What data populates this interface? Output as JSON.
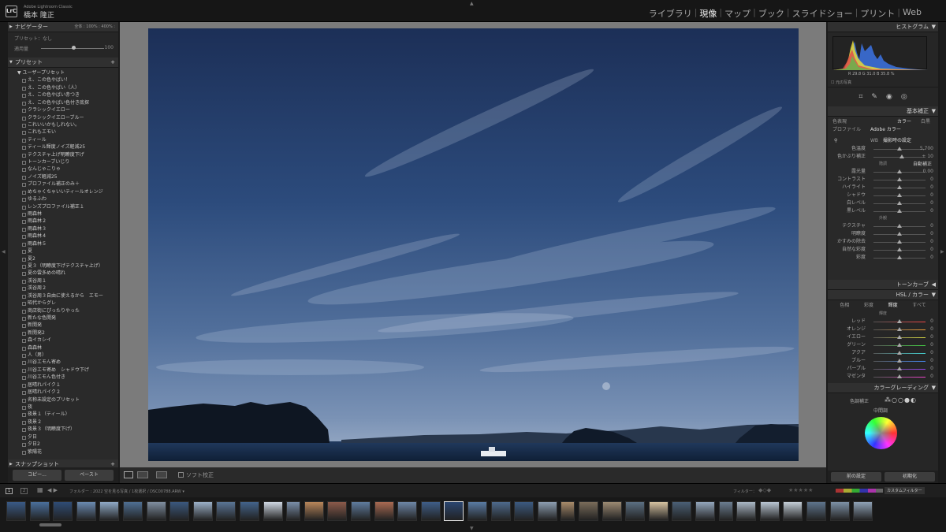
{
  "app": {
    "name": "Adobe Lightroom Classic",
    "user": "橋本 隆正",
    "logo": "LrC"
  },
  "modules": [
    {
      "label": "ライブラリ",
      "active": false
    },
    {
      "label": "現像",
      "active": true
    },
    {
      "label": "マップ",
      "active": false
    },
    {
      "label": "ブック",
      "active": false
    },
    {
      "label": "スライドショー",
      "active": false
    },
    {
      "label": "プリント",
      "active": false
    },
    {
      "label": "Web",
      "active": false
    }
  ],
  "left": {
    "navigator_title": "ナビゲーター",
    "navigator_zoom": "全体 : 100% : 400% :",
    "quick": {
      "label": "プリセット：なし",
      "amount_label": "適用量",
      "amount_value": "100"
    },
    "presets_title": "プリセット",
    "user_presets_title": "ユーザープリセット",
    "presets": [
      "え、この色やばい！",
      "え、この色やばい（人）",
      "え、この色やばい赤つき",
      "え、この色やばい色付き底探",
      "クラシックイエロー",
      "クラシックイエローブルー",
      "これいいかもしれない。",
      "これもエモい",
      "ティール",
      "ティール輝度ノイズ軽減25",
      "テクスチャ上げ明瞭度下げ",
      "トーンカーブいじり",
      "なんじゃこりゃ",
      "ノイズ軽減25",
      "プロファイル補正のみ＋",
      "めちゃくちゃいいティールオレンジ",
      "ゆるふわ",
      "レンズプロファイル補正１",
      "雨森林",
      "雨森林２",
      "雨森林３",
      "雨森林４",
      "雨森林５",
      "夏",
      "夏2",
      "夏３（明瞭度下げテクスチャ上げ）",
      "夏の雲多めの晴れ",
      "渓谷周１",
      "渓谷周２",
      "渓谷周３自由に使えるから　エモー",
      "昭代からグレ",
      "商店街にぴったりやった",
      "新たな色開発",
      "新開発",
      "新開発2",
      "森イカシイ",
      "森森林",
      "人（男）",
      "川谷エモん寄め",
      "川谷エモ寄め　シャドウ下げ",
      "川谷エモん色付き",
      "居晴れパイク１",
      "居晴れパイク２",
      "名称未設定のプリセット",
      "夜",
      "夜景１（ティール）",
      "夜景２",
      "夜景３（明瞭度下げ）",
      "夕日",
      "夕日2",
      "紫陽花"
    ],
    "snapshot_title": "スナップショット",
    "copy_label": "コピー...",
    "paste_label": "ペースト"
  },
  "right": {
    "histogram_title": "ヒストグラム",
    "hist_values": "R 29.8 G 31.0 B 35.8 %",
    "original_label": "元の写真",
    "basic_title": "基本補正",
    "treatment_label": "色表現",
    "color_label": "カラー",
    "bw_label": "白黒",
    "profile_label": "プロファイル",
    "profile_value": "Adobe カラー",
    "wb_label": "WB",
    "wb_value": "撮影時の設定",
    "wb_rows": [
      {
        "label": "色温度",
        "value": "5,700",
        "pos": 0.5
      },
      {
        "label": "色かぶり補正",
        "value": "+ 10",
        "pos": 0.55
      }
    ],
    "tone_title": "階調",
    "auto_label": "自動補正",
    "tone_rows": [
      {
        "label": "露光量",
        "value": "0.00",
        "pos": 0.5
      },
      {
        "label": "コントラスト",
        "value": "0",
        "pos": 0.5
      },
      {
        "label": "ハイライト",
        "value": "0",
        "pos": 0.5
      },
      {
        "label": "シャドウ",
        "value": "0",
        "pos": 0.5
      },
      {
        "label": "白レベル",
        "value": "0",
        "pos": 0.5
      },
      {
        "label": "黒レベル",
        "value": "0",
        "pos": 0.5
      }
    ],
    "presence_title": "外観",
    "presence_rows": [
      {
        "label": "テクスチャ",
        "value": "0",
        "pos": 0.5
      },
      {
        "label": "明瞭度",
        "value": "0",
        "pos": 0.5
      },
      {
        "label": "かすみの除去",
        "value": "0",
        "pos": 0.5
      },
      {
        "label": "自然な彩度",
        "value": "0",
        "pos": 0.5
      },
      {
        "label": "彩度",
        "value": "0",
        "pos": 0.5
      }
    ],
    "tone_curve_title": "トーンカーブ",
    "hsl_title": "HSL / カラー",
    "hsl_tabs": [
      {
        "label": "色相",
        "active": false
      },
      {
        "label": "彩度",
        "active": false
      },
      {
        "label": "輝度",
        "active": true
      },
      {
        "label": "すべて",
        "active": false
      }
    ],
    "hsl_subtitle": "輝度",
    "hsl_rows": [
      {
        "label": "レッド",
        "value": "0",
        "pos": 0.5,
        "color": "#e44"
      },
      {
        "label": "オレンジ",
        "value": "0",
        "pos": 0.5,
        "color": "#e93"
      },
      {
        "label": "イエロー",
        "value": "0",
        "pos": 0.5,
        "color": "#dd4"
      },
      {
        "label": "グリーン",
        "value": "0",
        "pos": 0.5,
        "color": "#4c4"
      },
      {
        "label": "アクア",
        "value": "0",
        "pos": 0.5,
        "color": "#4cc"
      },
      {
        "label": "ブルー",
        "value": "0",
        "pos": 0.5,
        "color": "#48e"
      },
      {
        "label": "パープル",
        "value": "0",
        "pos": 0.5,
        "color": "#94e"
      },
      {
        "label": "マゼンタ",
        "value": "0",
        "pos": 0.5,
        "color": "#e4c"
      }
    ],
    "color_grading_title": "カラーグレーディング",
    "cg_adjust_label": "色調補正",
    "cg_midtones_label": "中間調",
    "prev_label": "前の設定",
    "reset_label": "初期化"
  },
  "toolbar": {
    "soft_proof_label": "ソフト校正"
  },
  "filmstrip": {
    "path": "フォルダー : 2022 空を見る写真 / 1枚選択 / DSC00788.ARW ▾",
    "filter_label": "フィルター：",
    "custom_filter_label": "カスタムフィルター",
    "screen1": "1",
    "screen2": "2"
  }
}
